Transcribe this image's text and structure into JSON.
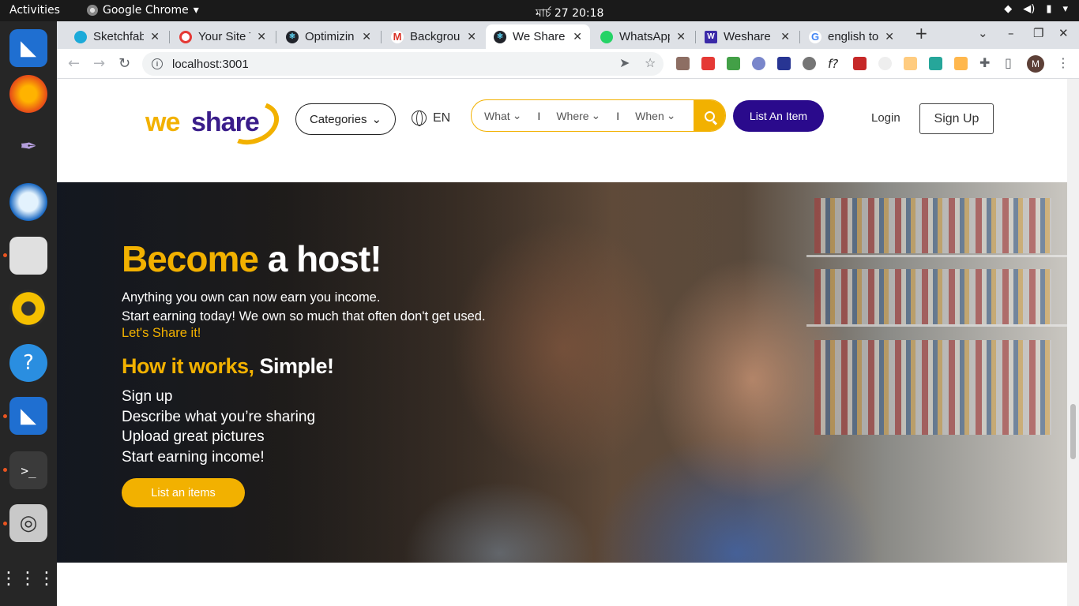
{
  "os": {
    "activities": "Activities",
    "app_name": "Google Chrome",
    "clock": "মার্চ 27  20:18"
  },
  "browser": {
    "tabs": [
      {
        "title": "Sketchfab",
        "favicon_color": "#1caad9"
      },
      {
        "title": "Your Site T",
        "favicon_color": "#e53935"
      },
      {
        "title": "Optimizin",
        "favicon_color": "#20232a"
      },
      {
        "title": "Backgrou",
        "favicon_color": "#d93025"
      },
      {
        "title": "We Share",
        "favicon_color": "#20232a",
        "active": true
      },
      {
        "title": "WhatsApp",
        "favicon_color": "#25d366"
      },
      {
        "title": "Weshare r",
        "favicon_color": "#3b2aa8"
      },
      {
        "title": "english to",
        "favicon_color": "#4285f4"
      }
    ],
    "url": "localhost:3001",
    "profile_initial": "M"
  },
  "site": {
    "logo_part1": "we",
    "logo_part2": "share",
    "categories_label": "Categories",
    "language": "EN",
    "search": {
      "what": "What",
      "where": "Where",
      "when": "When",
      "separator": "I"
    },
    "list_item_label": "List An Item",
    "login_label": "Login",
    "signup_label": "Sign Up"
  },
  "hero": {
    "title_highlight": "Become",
    "title_rest": " a host!",
    "line1": "Anything you own can now earn you income.",
    "line2": "Start earning today! We own so much that often don't get used.",
    "cta_text": "Let's Share it!",
    "how_highlight": "How it works,",
    "how_rest": " Simple!",
    "steps": [
      "Sign up",
      "Describe what you’re sharing",
      "Upload great pictures",
      "Start earning income!"
    ],
    "button_label": "List an items"
  },
  "colors": {
    "brand_yellow": "#f2b100",
    "brand_purple": "#2a0a8c"
  }
}
